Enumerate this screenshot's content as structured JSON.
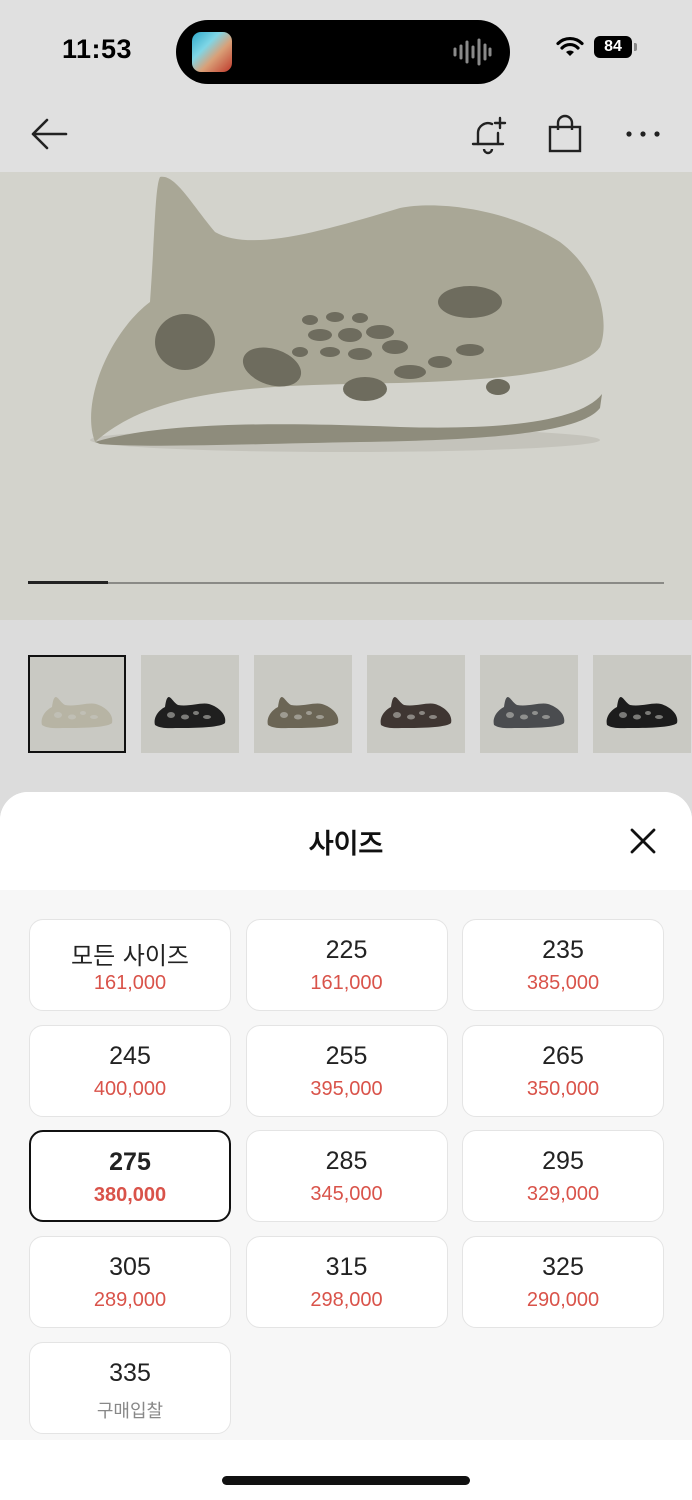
{
  "status_bar": {
    "time": "11:53",
    "battery": "84"
  },
  "header": {
    "back_icon": "arrow-left-icon",
    "actions": [
      "bell-plus-icon",
      "shopping-bag-icon",
      "more-horizontal-icon"
    ]
  },
  "gallery": {
    "progress": 0.125,
    "thumbnails": [
      {
        "color": "#b7b4a4",
        "selected": true
      },
      {
        "color": "#1f1f1f",
        "selected": false
      },
      {
        "color": "#6b6555",
        "selected": false
      },
      {
        "color": "#3f3632",
        "selected": false
      },
      {
        "color": "#4a4c4f",
        "selected": false
      },
      {
        "color": "#1c1c1c",
        "selected": false
      }
    ]
  },
  "sheet": {
    "title": "사이즈",
    "sizes": [
      {
        "label": "모든 사이즈",
        "price": "161,000"
      },
      {
        "label": "225",
        "price": "161,000"
      },
      {
        "label": "235",
        "price": "385,000"
      },
      {
        "label": "245",
        "price": "400,000"
      },
      {
        "label": "255",
        "price": "395,000"
      },
      {
        "label": "265",
        "price": "350,000"
      },
      {
        "label": "275",
        "price": "380,000",
        "selected": true
      },
      {
        "label": "285",
        "price": "345,000"
      },
      {
        "label": "295",
        "price": "329,000"
      },
      {
        "label": "305",
        "price": "289,000"
      },
      {
        "label": "315",
        "price": "298,000"
      },
      {
        "label": "325",
        "price": "290,000"
      },
      {
        "label": "335",
        "price": "구매입찰",
        "muted": true
      }
    ]
  },
  "colors": {
    "price": "#d9534a",
    "muted": "#888888",
    "selected_border": "#111111"
  }
}
